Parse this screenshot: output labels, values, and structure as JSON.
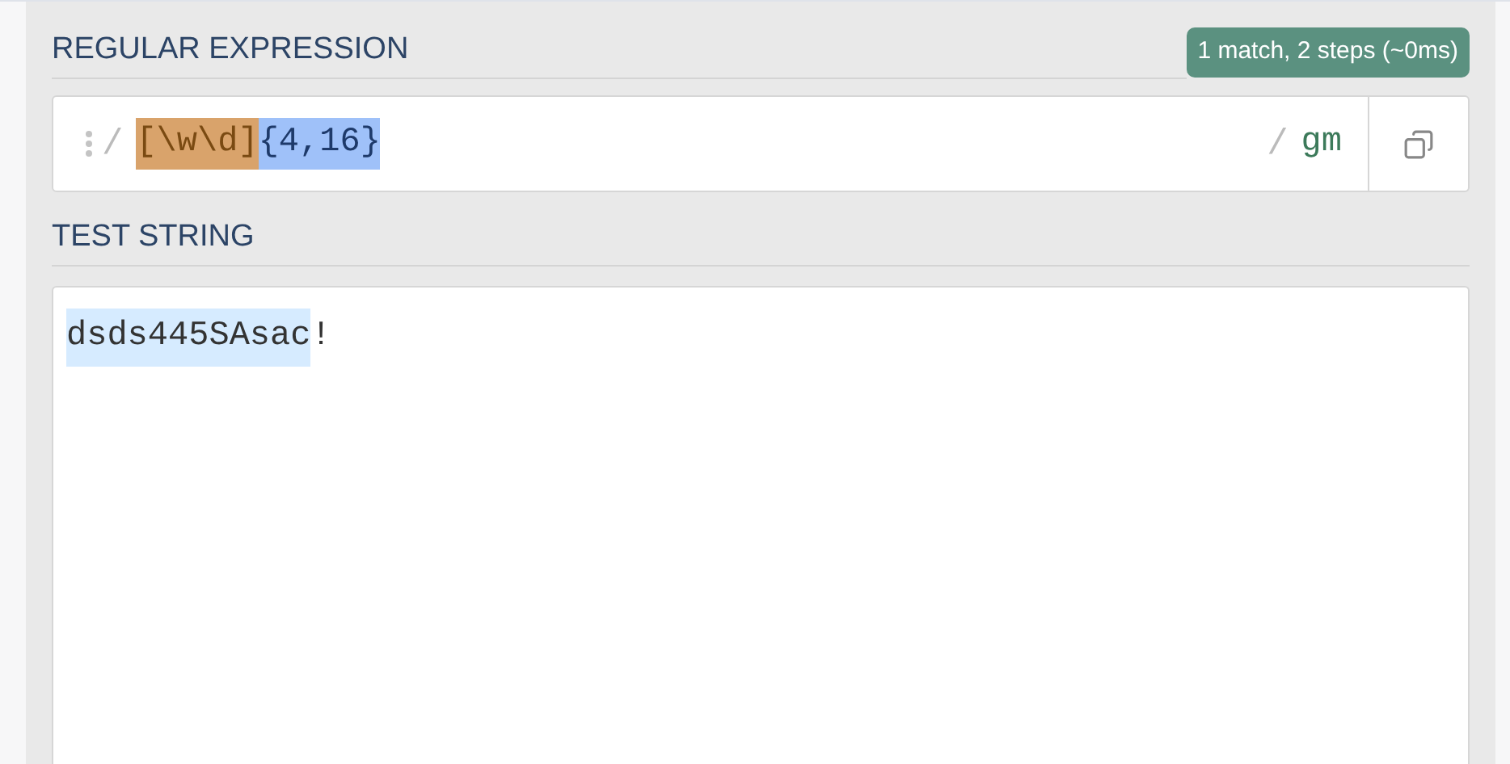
{
  "regex_section": {
    "heading": "REGULAR EXPRESSION",
    "match_info": "1 match, 2 steps (~0ms)",
    "delimiter_open": "/",
    "tokens": [
      {
        "text": "[\\w\\d]",
        "kind": "group",
        "color": "#d9a36b"
      },
      {
        "text": "{4,16}",
        "kind": "quantifier",
        "color": "#9fc1f9"
      }
    ],
    "delimiter_close": "/",
    "flags": "gm"
  },
  "test_section": {
    "heading": "TEST STRING",
    "segments": [
      {
        "text": "dsds445SAsac",
        "matched": true
      },
      {
        "text": "!",
        "matched": false
      }
    ]
  }
}
